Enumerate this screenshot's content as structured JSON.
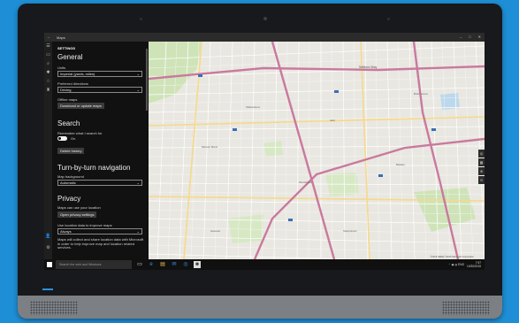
{
  "window": {
    "app_title": "Maps",
    "back": "←",
    "controls": [
      "–",
      "□",
      "✕"
    ]
  },
  "sidebar_icons": [
    "☰",
    "▭",
    "⌕",
    "✱",
    "☆",
    "♜"
  ],
  "sidebar_bottom_icons": [
    "👤",
    "⚙"
  ],
  "settings": {
    "header": "SETTINGS",
    "general": {
      "title": "General",
      "units_label": "Units",
      "units_value": "Imperial (yards, miles)",
      "directions_label": "Preferred directions",
      "directions_value": "Driving",
      "offline_label": "Offline maps",
      "offline_button": "Download or update maps"
    },
    "search": {
      "title": "Search",
      "remember_label": "Remember what I search for",
      "toggle_state": "On",
      "delete_button": "Delete history"
    },
    "navigation": {
      "title": "Turn-by-turn navigation",
      "background_label": "Map background",
      "background_value": "Automatic"
    },
    "privacy": {
      "title": "Privacy",
      "location_text": "Maps can use your location",
      "location_button": "Open privacy settings",
      "improve_label": "Use location data to improve maps",
      "improve_value": "Always",
      "improve_desc": "Maps will collect and share location data with Microsoft in order to help improve map and location related services."
    }
  },
  "map": {
    "road_label": "Settlers Way",
    "copyright": "©2015 HERE ©2015 Microsoft Corporation",
    "tools": [
      "◎",
      "▦",
      "⊕",
      "⊖"
    ]
  },
  "taskbar": {
    "search_placeholder": "Search the web and Windows",
    "apps": [
      "▭",
      "e",
      "▤",
      "✉",
      "◎",
      "☻"
    ],
    "tray_icons": "⌃ ▣ ◍ ENG",
    "time": "7:57",
    "date": "10/30/2015"
  }
}
